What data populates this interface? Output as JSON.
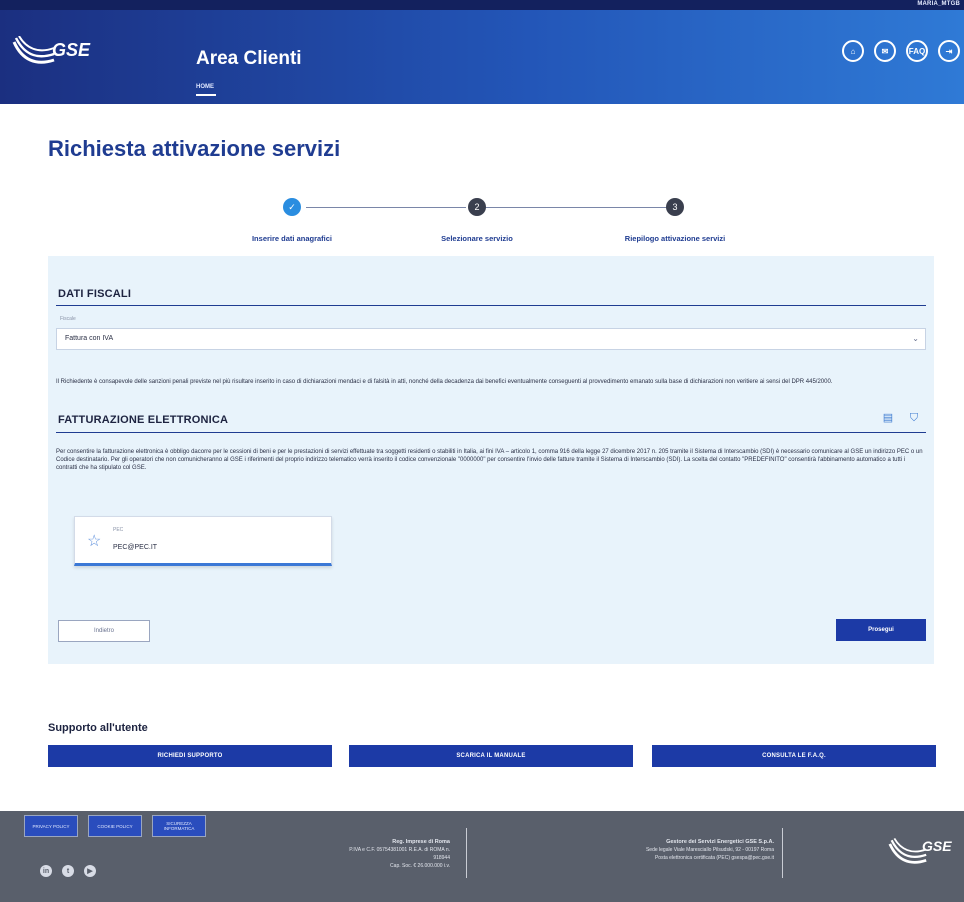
{
  "header": {
    "user": "MARIA_MTGB",
    "logo_text": "GSE",
    "app_title": "Area Clienti",
    "breadcrumb": "HOME",
    "icons": [
      "home-icon",
      "chat-icon",
      "faq-icon",
      "logout-icon"
    ],
    "faq_label": "FAQ"
  },
  "page": {
    "title": "Richiesta attivazione servizi"
  },
  "stepper": {
    "steps": [
      {
        "label": "Inserire dati anagrafici",
        "state": "active"
      },
      {
        "label": "Selezionare servizio",
        "state": "inactive"
      },
      {
        "label": "Riepilogo attivazione servizi",
        "state": "inactive"
      }
    ],
    "check_glyph": "✓",
    "step_numbers": [
      "2",
      "3"
    ]
  },
  "dati_fiscali": {
    "title": "DATI FISCALI",
    "field_label": "Fiscale",
    "selected_value": "Fattura con IVA",
    "note": "Il Richiedente è consapevole delle sanzioni penali previste nel più risultare inserito in caso di dichiarazioni mendaci e di falsità in atti, nonché della decadenza dai benefici eventualmente conseguenti al provvedimento emanato sulla base di dichiarazioni non veritiere ai sensi del DPR 445/2000."
  },
  "fatturazione": {
    "title": "FATTURAZIONE ELETTRONICA",
    "description": "Per consentire la fatturazione elettronica è obbligo dacorre per le cessioni di beni e per le prestazioni di servizi effettuate tra soggetti residenti o stabiliti in Italia, ai fini IVA – articolo 1, comma 916 della legge 27 dicembre 2017 n. 205 tramite il Sistema di Interscambio (SDI) è necessario comunicare al GSE un indirizzo PEC o un Codice destinatario. Per gli operatori che non comunicheranno al GSE i riferimenti del proprio indirizzo telematico verrà inserito il codice convenzionale \"0000000\" per consentire l'invio delle fatture tramite il Sistema di Interscambio (SDI). La scelta del contatto \"PREDEFINITO\" consentirà l'abbinamento automatico a tutti i contratti che ha stipulato col GSE.",
    "card": {
      "label": "PEC",
      "value": "PEC@PEC.IT"
    },
    "icons": [
      "document-icon",
      "shield-icon"
    ]
  },
  "actions": {
    "back_label": "Indietro",
    "next_label": "Prosegui"
  },
  "support": {
    "title": "Supporto all'utente",
    "buttons": [
      "RICHIEDI SUPPORTO",
      "SCARICA IL MANUALE",
      "CONSULTA LE F.A.Q."
    ]
  },
  "footer": {
    "badges": [
      "PRIVACY POLICY",
      "COOKIE POLICY",
      "SICUREZZA INFORMATICA"
    ],
    "socials": [
      "linkedin-icon",
      "twitter-icon",
      "youtube-icon"
    ],
    "social_glyphs": [
      "in",
      "t",
      "▶"
    ],
    "col1": {
      "title": "Reg. Imprese di Roma",
      "line1": "P.IVA e C.F. 05754381001 R.E.A. di ROMA n.",
      "line2": "918944",
      "line3": "Cap. Soc. € 26.000.000 i.v."
    },
    "col2": {
      "title": "Gestore dei Servizi Energetici GSE S.p.A.",
      "line1": "Sede legale Viale Maresciallo Pilsudski, 92 - 00197 Roma",
      "line2": "Posta elettronica certificata (PEC) gsespa@pec.gse.it"
    },
    "logo_text": "GSE"
  },
  "colors": {
    "brand_dark": "#1b2f80",
    "brand_primary": "#1c3aa6",
    "accent_blue": "#2a8de0",
    "panel_bg": "#e8f3fb",
    "footer_bg": "#595f6b"
  }
}
